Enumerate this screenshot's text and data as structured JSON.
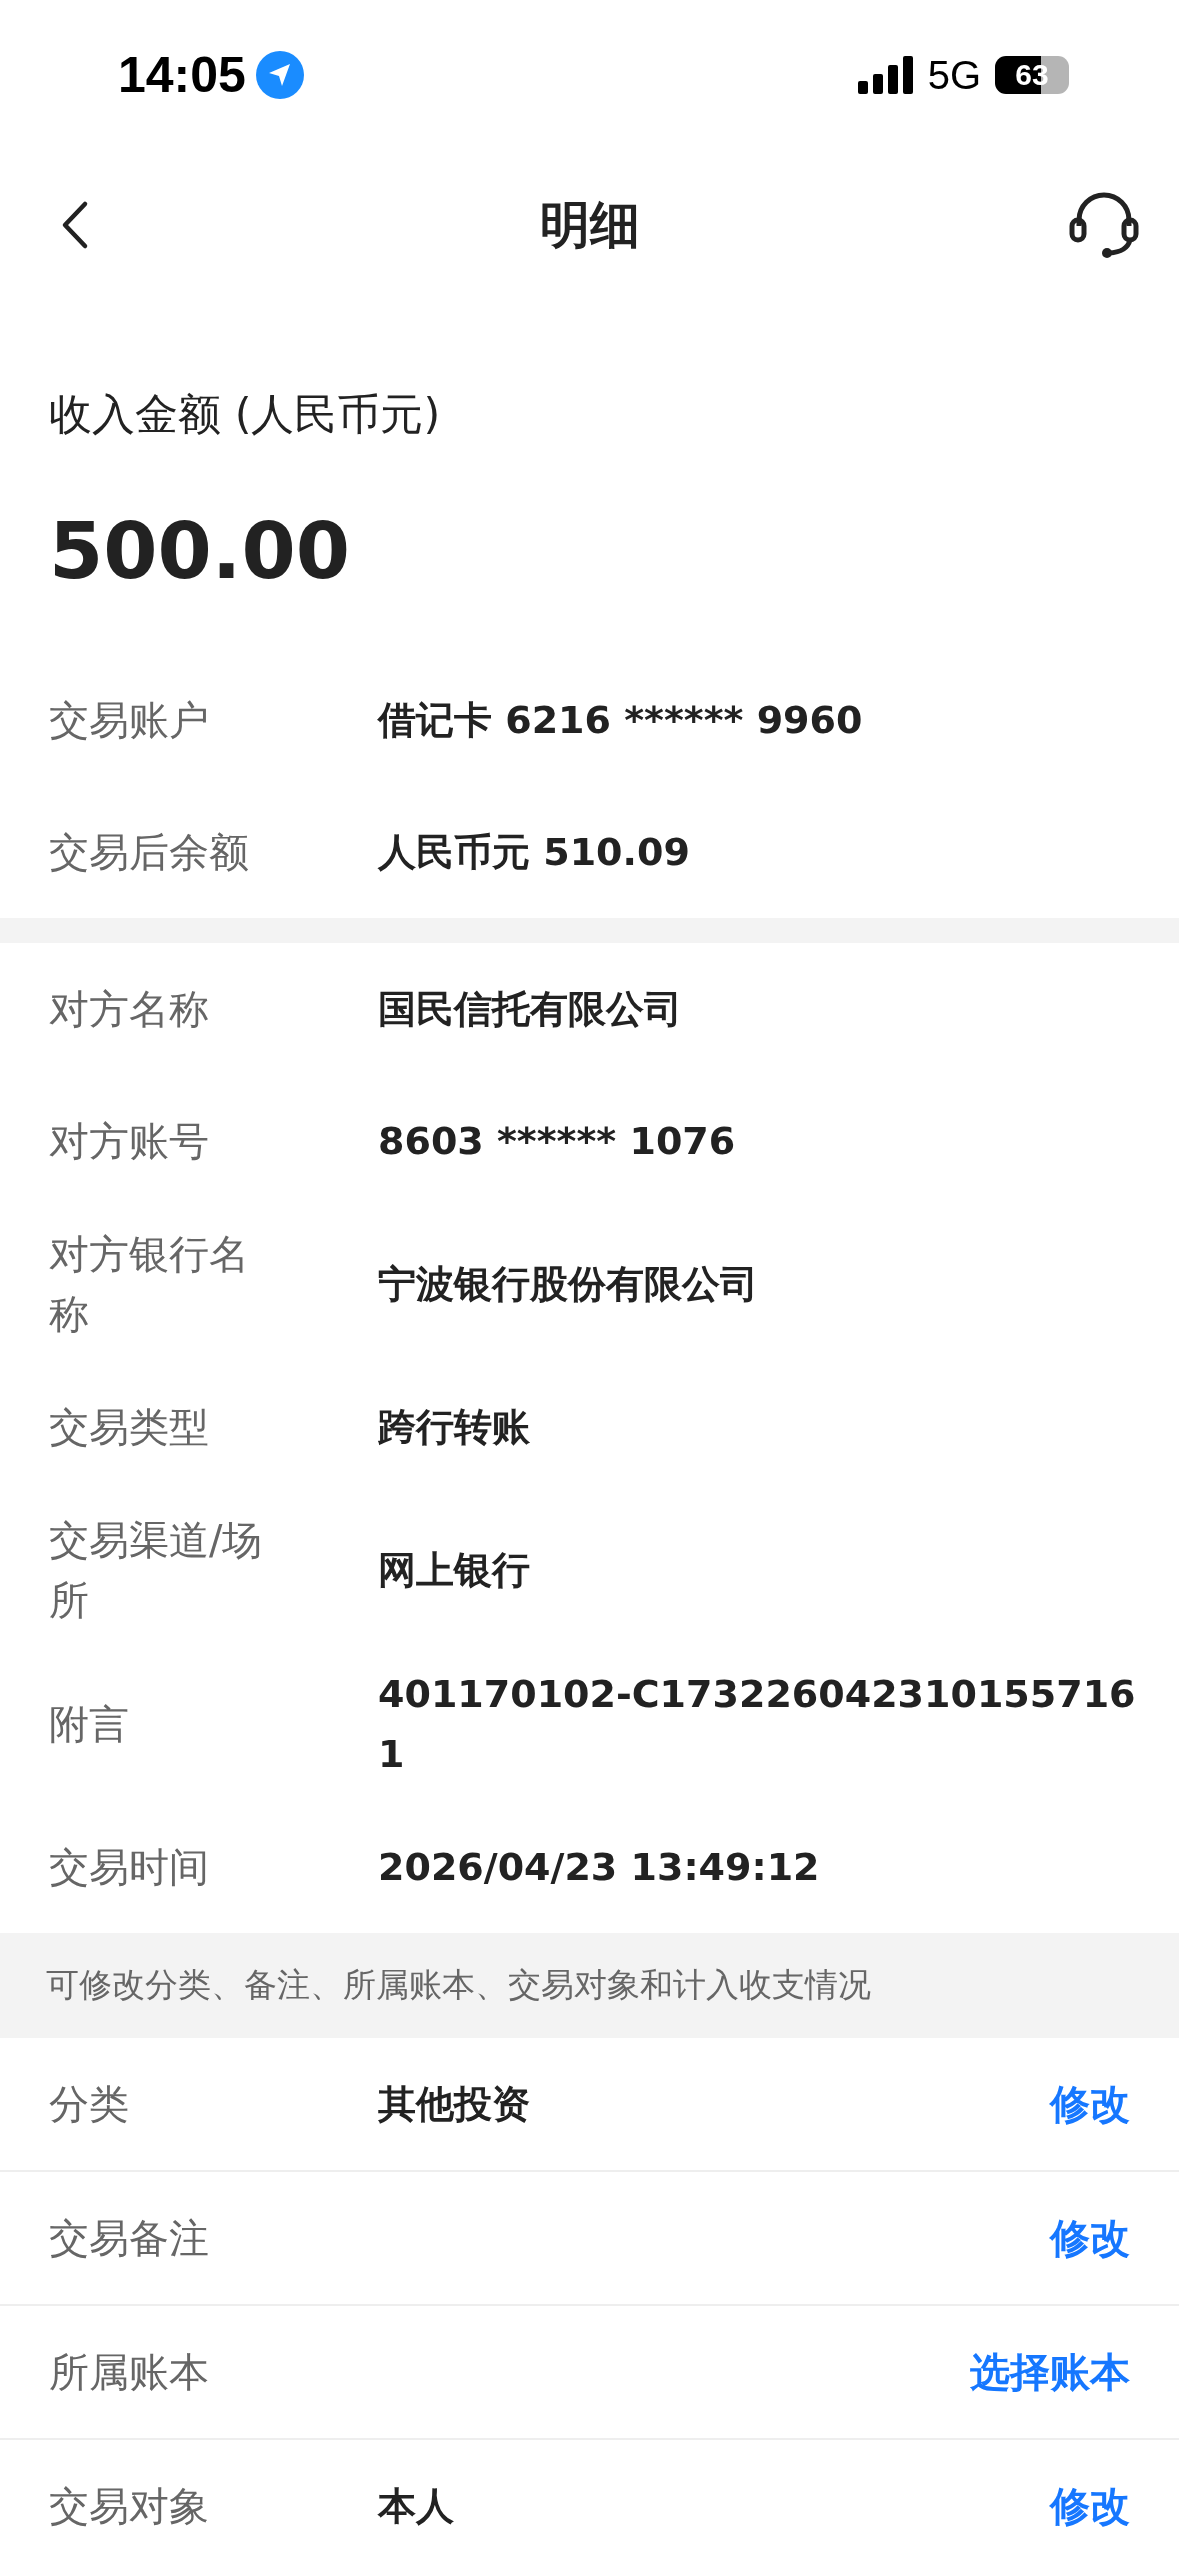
{
  "status_bar": {
    "time": "14:05",
    "network": "5G",
    "battery": "63"
  },
  "nav": {
    "title": "明细"
  },
  "amount": {
    "label": "收入金额 (人民币元)",
    "value": "500.00"
  },
  "account_rows": [
    {
      "label": "交易账户",
      "value": "借记卡 6216 ****** 9960"
    },
    {
      "label": "交易后余额",
      "value": "人民币元 510.09"
    }
  ],
  "detail_rows": [
    {
      "label": "对方名称",
      "value": "国民信托有限公司"
    },
    {
      "label": "对方账号",
      "value": "8603 ****** 1076"
    },
    {
      "label": "对方银行名称",
      "value": "宁波银行股份有限公司"
    },
    {
      "label": "交易类型",
      "value": "跨行转账"
    },
    {
      "label": "交易渠道/场所",
      "value": "网上银行"
    },
    {
      "label": "附言",
      "value": "401170102-C1732260423101557161"
    },
    {
      "label": "交易时间",
      "value": "2026/04/23 13:49:12"
    }
  ],
  "edit_hint": "可修改分类、备注、所属账本、交易对象和计入收支情况",
  "edit_rows": [
    {
      "label": "分类",
      "value": "其他投资",
      "action": "修改"
    },
    {
      "label": "交易备注",
      "action": "修改"
    },
    {
      "label": "所属账本",
      "action": "选择账本"
    },
    {
      "label": "交易对象",
      "value": "本人",
      "action": "修改"
    }
  ]
}
